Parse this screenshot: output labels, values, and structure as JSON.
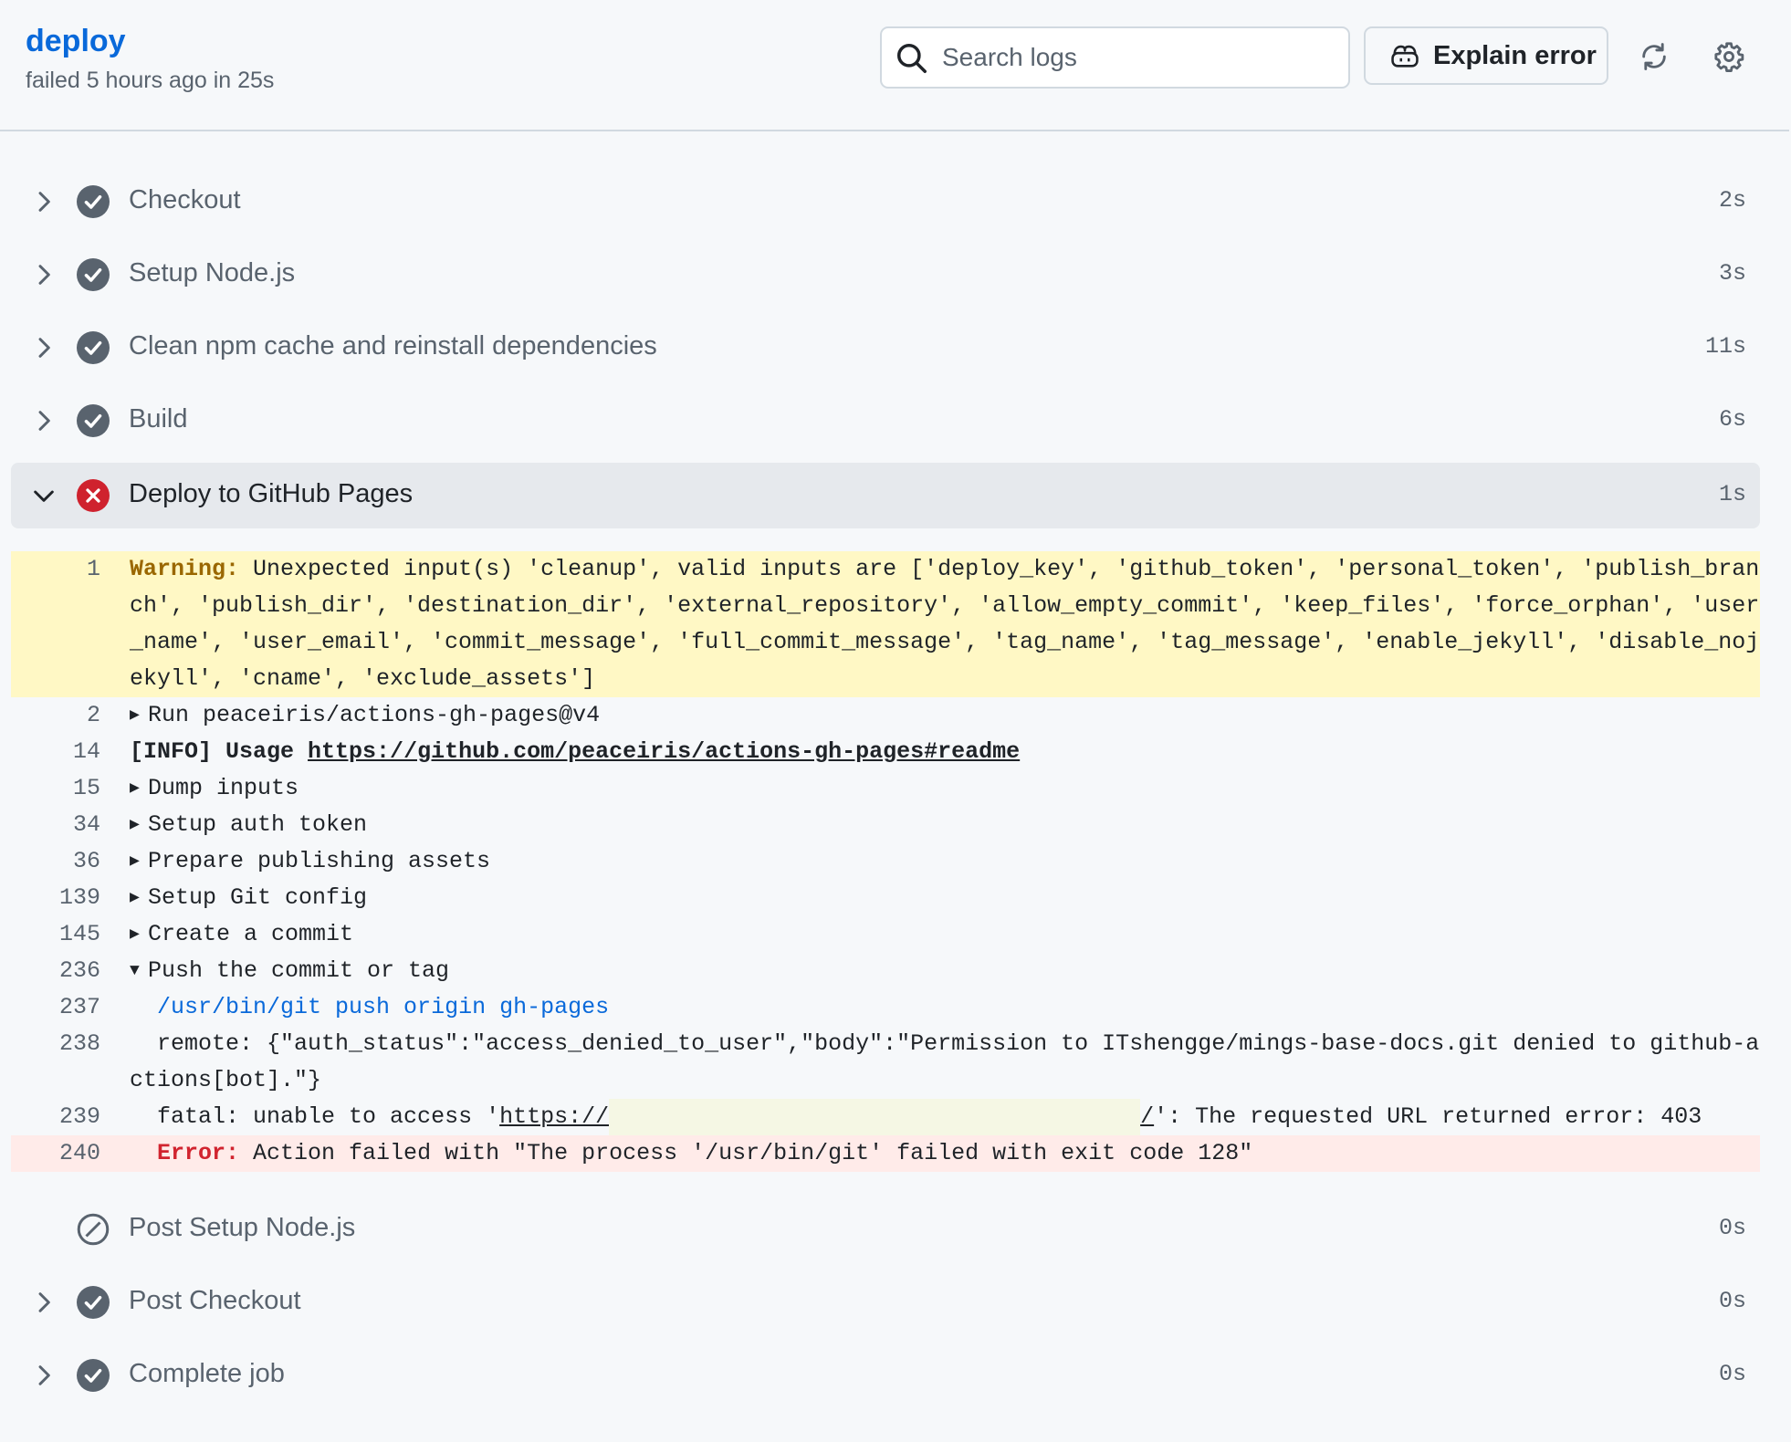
{
  "header": {
    "job_name": "deploy",
    "job_meta": "failed 5 hours ago in 25s",
    "search_placeholder": "Search logs",
    "explain_label": "Explain error",
    "icons": [
      "search-icon",
      "copilot-icon",
      "refresh-icon",
      "gear-icon"
    ]
  },
  "steps_before": [
    {
      "name": "Checkout",
      "duration": "2s",
      "status": "success"
    },
    {
      "name": "Setup Node.js",
      "duration": "3s",
      "status": "success"
    },
    {
      "name": "Clean npm cache and reinstall dependencies",
      "duration": "11s",
      "status": "success"
    },
    {
      "name": "Build",
      "duration": "6s",
      "status": "success"
    }
  ],
  "active_step": {
    "name": "Deploy to GitHub Pages",
    "duration": "1s",
    "status": "failure"
  },
  "log": {
    "l1": {
      "num": "1",
      "label": "Warning:",
      "text": " Unexpected input(s) 'cleanup', valid inputs are ['deploy_key', 'github_token', 'personal_token', 'publish_branch', 'publish_dir', 'destination_dir', 'external_repository', 'allow_empty_commit', 'keep_files', 'force_orphan', 'user_name', 'user_email', 'commit_message', 'full_commit_message', 'tag_name', 'tag_message', 'enable_jekyll', 'disable_nojekyll', 'cname', 'exclude_assets']"
    },
    "l2": {
      "num": "2",
      "text": "Run peaceiris/actions-gh-pages@v4"
    },
    "l14": {
      "num": "14",
      "text": "[INFO] Usage ",
      "link": "https://github.com/peaceiris/actions-gh-pages#readme"
    },
    "l15": {
      "num": "15",
      "text": "Dump inputs"
    },
    "l34": {
      "num": "34",
      "text": "Setup auth token"
    },
    "l36": {
      "num": "36",
      "text": "Prepare publishing assets"
    },
    "l139": {
      "num": "139",
      "text": "Setup Git config"
    },
    "l145": {
      "num": "145",
      "text": "Create a commit"
    },
    "l236": {
      "num": "236",
      "text": "Push the commit or tag"
    },
    "l237": {
      "num": "237",
      "text": "  /usr/bin/git push origin gh-pages"
    },
    "l238": {
      "num": "238",
      "text": "  remote: {\"auth_status\":\"access_denied_to_user\",\"body\":\"Permission to ITshengge/mings-base-docs.git denied to github-actions[bot].\"}"
    },
    "l239": {
      "num": "239",
      "prefix": "  fatal: unable to access '",
      "link_start": "https://",
      "link_end": "/",
      "suffix": "': The requested URL returned error: 403"
    },
    "l240": {
      "num": "240",
      "label": "  Error:",
      "text": " Action failed with \"The process '/usr/bin/git' failed with exit code 128\""
    }
  },
  "steps_after": [
    {
      "name": "Post Setup Node.js",
      "duration": "0s",
      "status": "skipped"
    },
    {
      "name": "Post Checkout",
      "duration": "0s",
      "status": "success"
    },
    {
      "name": "Complete job",
      "duration": "0s",
      "status": "success"
    }
  ],
  "colors": {
    "link": "#0969da",
    "failure": "#cf222e",
    "success_icon": "#59636e",
    "warning_bg": "#fff8c5",
    "error_bg": "#ffebe9"
  }
}
